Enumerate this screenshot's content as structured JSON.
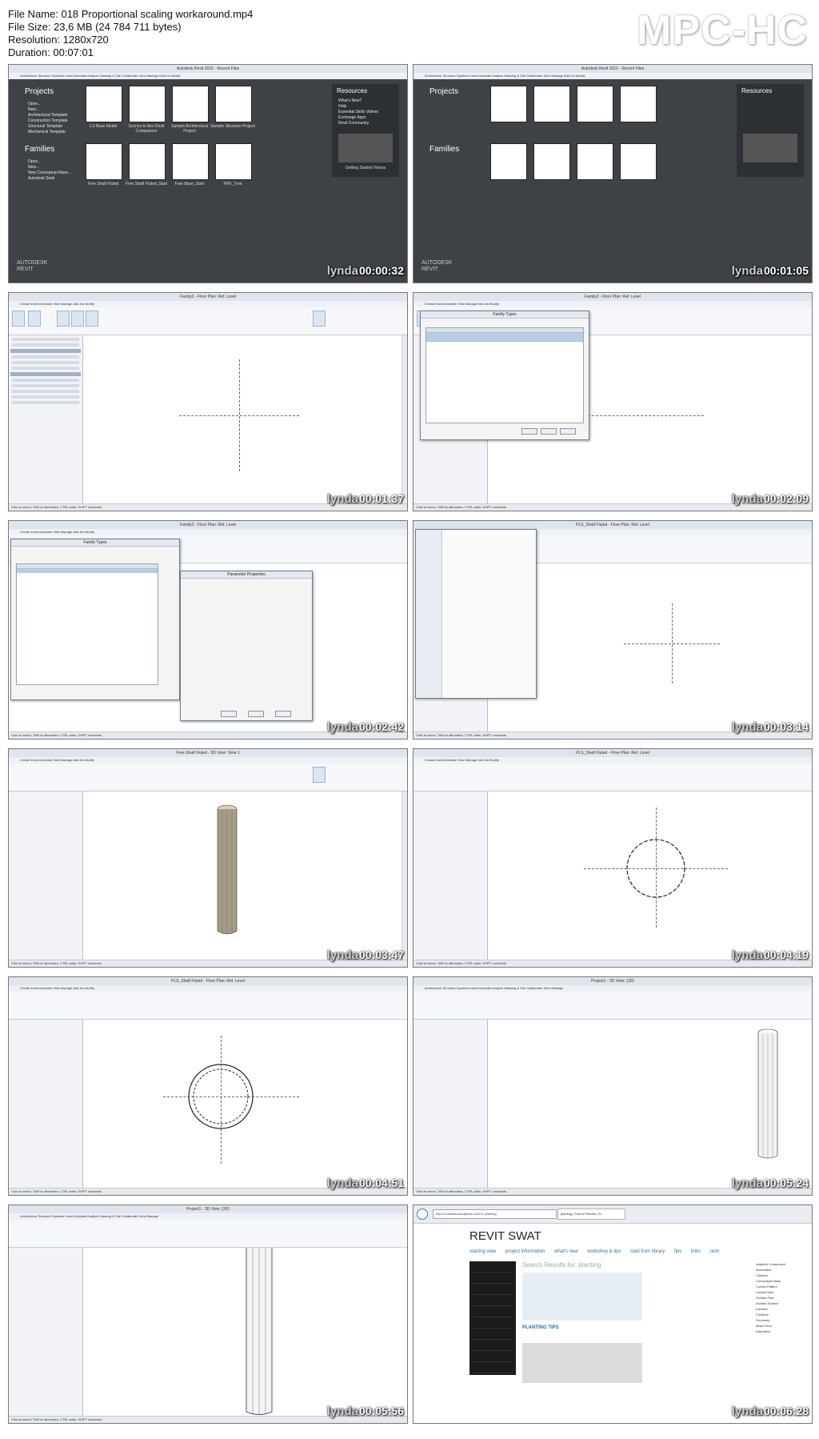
{
  "header": {
    "file_name": "File Name: 018 Proportional scaling workaround.mp4",
    "file_size": "File Size: 23,6 MB (24 784 711 bytes)",
    "resolution": "Resolution: 1280x720",
    "duration": "Duration: 00:07:01"
  },
  "logo": "MPC-HC",
  "watermark": "lynda",
  "thumbnails": [
    {
      "time": "00:00:32",
      "title": "Autodesk Revit 2015 - Recent Files"
    },
    {
      "time": "00:01:05",
      "title": "Autodesk Revit 2015 - Recent Files"
    },
    {
      "time": "00:01:37",
      "title": "Family2 - Floor Plan: Ref. Level"
    },
    {
      "time": "00:02:09",
      "title": "Family2 - Floor Plan: Ref. Level"
    },
    {
      "time": "00:02:42",
      "title": "Family2 - Floor Plan: Ref. Level"
    },
    {
      "time": "00:03:14",
      "title": "PLS_Shaft Fluted - Floor Plan: Ref. Level"
    },
    {
      "time": "00:03:47",
      "title": "Free Shaft Fluted - 3D View: View 1"
    },
    {
      "time": "00:04:19",
      "title": "PLS_Shaft Fluted - Floor Plan: Ref. Level"
    },
    {
      "time": "00:04:51",
      "title": "PLS_Shaft Fluted - Floor Plan: Ref. Level"
    },
    {
      "time": "00:05:24",
      "title": "Project1 - 3D View: {3D}"
    },
    {
      "time": "00:05:56",
      "title": "Project1 - 3D View: {3D}"
    },
    {
      "time": "00:06:28",
      "title": ""
    }
  ],
  "start_screen": {
    "projects": "Projects",
    "families": "Families",
    "resources": "Resources",
    "project_links": [
      "Open...",
      "New...",
      "Architectural Template",
      "Construction Template",
      "Structural Template",
      "Mechanical Template"
    ],
    "family_links": [
      "Open...",
      "New...",
      "New Conceptual Mass...",
      "Autodesk Seek"
    ],
    "resource_links": [
      "What's New?",
      "Help",
      "Essential Skills Videos",
      "Exchange Apps",
      "Revit Community"
    ],
    "project_tiles": [
      "1.0 Base Model",
      "Sconce to Ann Revit Comparison",
      "Sample Architectural Project",
      "Sample Structure Project"
    ],
    "family_tiles": [
      "Free Shaft Fluted",
      "Free Shaft Fluted_Start",
      "Free Base_Start",
      "PRF_Tree"
    ],
    "getting_started": "Getting Started Videos",
    "autodesk": "AUTODESK",
    "revit": "REVIT"
  },
  "dialogs": {
    "family_types": "Family Types",
    "parameter_properties": "Parameter Properties"
  },
  "browser": {
    "url": "http://revitswat.wordpress.com/?s=planting",
    "tab": "planting | Search Results | R...",
    "site_title": "REVIT SWAT",
    "nav": [
      "starting view",
      "project information",
      "what's new",
      "workshop & tips",
      "load from library",
      "fips",
      "links",
      "revit"
    ],
    "search_heading": "Search Results for: planting",
    "post_title": "PLANTING TIPS",
    "categories": [
      "Adaptive Component",
      "Annotation",
      "Classics",
      "Conceptual Mass",
      "Curtain Pattern",
      "Curtain Wall",
      "Divided Path",
      "Divided Surface",
      "Families",
      "Furniture",
      "Geometry",
      "Mass Form",
      "Inspiration"
    ]
  },
  "status_text": "Click to select, TAB for alternates, CTRL adds, SHIFT unselects."
}
